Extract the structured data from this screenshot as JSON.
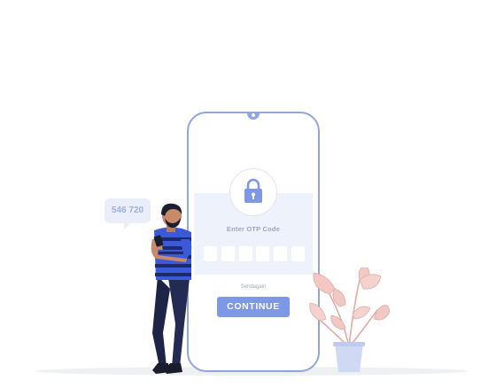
{
  "otp_screen": {
    "title": "Enter OTP Code",
    "code_slots": [
      "",
      "",
      "",
      "",
      "",
      ""
    ],
    "send_again_label": "Sendagain",
    "continue_label": "CONTINUE"
  },
  "sms_bubble": {
    "code": "546 720"
  },
  "colors": {
    "accent": "#7d98e6",
    "phone_frame": "#8fa6de",
    "panel": "#eef2fa",
    "muted_text": "#9aa7c2",
    "plant_leaf": "#f2c8c3",
    "pot": "#cfd9f3"
  }
}
